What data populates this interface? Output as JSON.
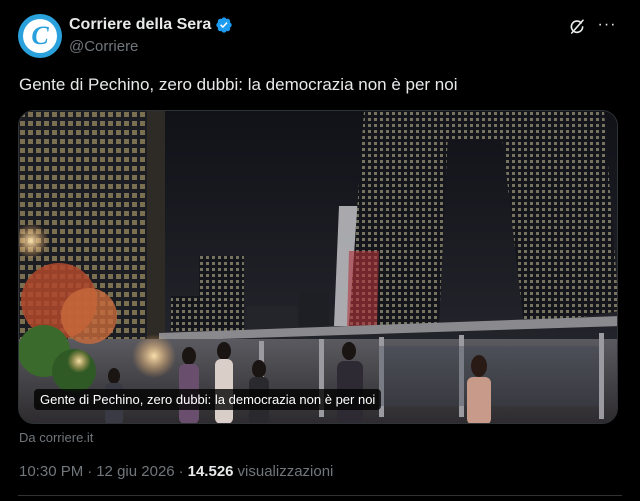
{
  "author": {
    "display_name": "Corriere della Sera",
    "handle": "@Corriere",
    "avatar_letter": "C",
    "verified": true
  },
  "actions": {
    "grok_icon": "grok-icon",
    "more_label": "···"
  },
  "tweet": {
    "text": "Gente di Pechino, zero dubbi: la democrazia non è per noi"
  },
  "card": {
    "overlay_title": "Gente di Pechino, zero dubbi: la democrazia non è per noi",
    "source": "Da corriere.it"
  },
  "meta": {
    "time": "10:30 PM",
    "sep1": "·",
    "date": "12 giu 2026",
    "sep2": "·",
    "views_count": "14.526",
    "views_label": "visualizzazioni"
  },
  "colors": {
    "background": "#000000",
    "text": "#e7e9ea",
    "secondary": "#71767b",
    "verified": "#1d9bf0",
    "avatar": "#2aa1dc",
    "border": "#2f3336"
  }
}
